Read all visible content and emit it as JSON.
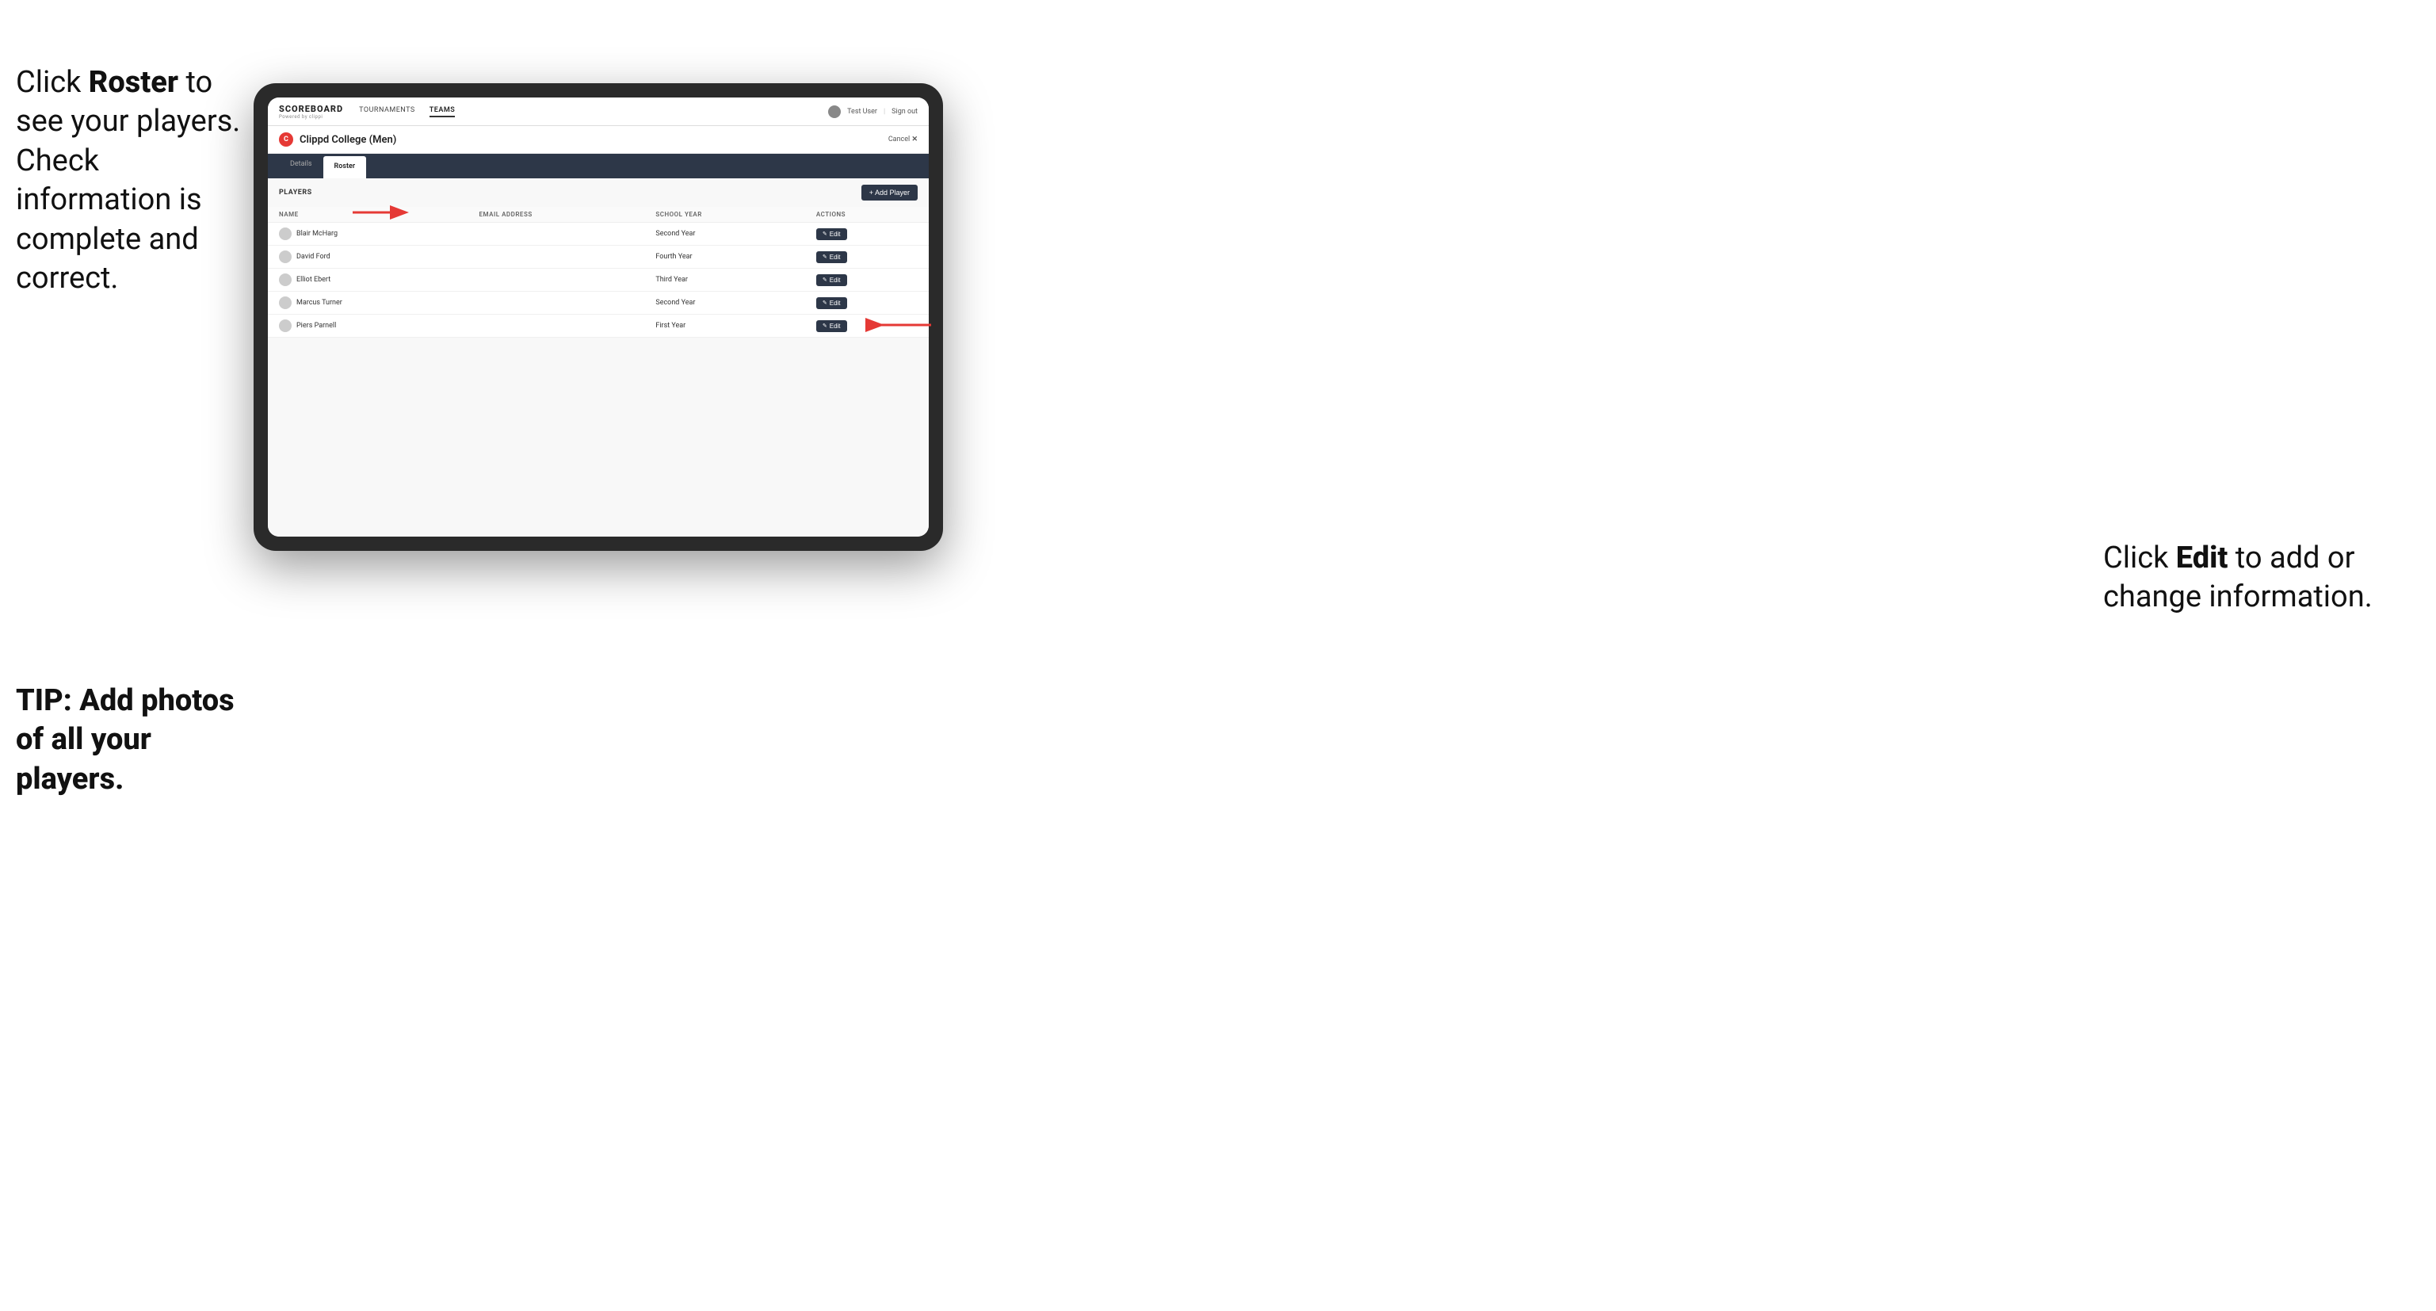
{
  "instructions": {
    "left_text_part1": "Click ",
    "left_text_bold": "Roster",
    "left_text_part2": " to see your players. Check information is complete and correct.",
    "tip_text": "TIP: Add photos of all your players.",
    "right_text_part1": "Click ",
    "right_text_bold": "Edit",
    "right_text_part2": " to add or change information."
  },
  "navbar": {
    "logo_main": "SCOREBOARD",
    "logo_sub": "Powered by clippi",
    "links": [
      "TOURNAMENTS",
      "TEAMS"
    ],
    "active_link": "TEAMS",
    "user": "Test User",
    "sign_out": "Sign out"
  },
  "team": {
    "logo_letter": "C",
    "name": "Clippd College (Men)",
    "cancel": "Cancel",
    "cancel_x": "✕"
  },
  "tabs": [
    {
      "label": "Details",
      "active": false
    },
    {
      "label": "Roster",
      "active": true
    }
  ],
  "players_section": {
    "label": "PLAYERS",
    "add_button": "+ Add Player"
  },
  "table": {
    "columns": [
      "NAME",
      "EMAIL ADDRESS",
      "SCHOOL YEAR",
      "ACTIONS"
    ],
    "rows": [
      {
        "name": "Blair McHarg",
        "email": "",
        "school_year": "Second Year"
      },
      {
        "name": "David Ford",
        "email": "",
        "school_year": "Fourth Year"
      },
      {
        "name": "Elliot Ebert",
        "email": "",
        "school_year": "Third Year"
      },
      {
        "name": "Marcus Turner",
        "email": "",
        "school_year": "Second Year"
      },
      {
        "name": "Piers Parnell",
        "email": "",
        "school_year": "First Year"
      }
    ],
    "edit_label": "Edit"
  }
}
